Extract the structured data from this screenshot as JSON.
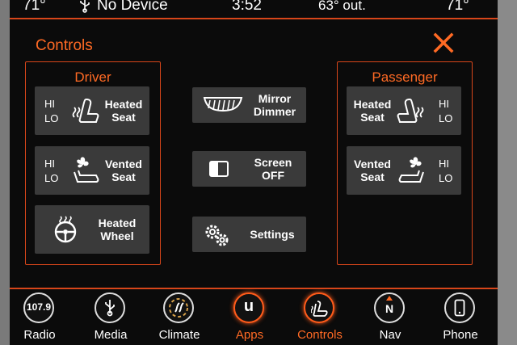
{
  "status": {
    "temp_left": "71°",
    "device": "No Device",
    "time": "3:52",
    "outside": "63° out.",
    "temp_right": "71°"
  },
  "header": {
    "title": "Controls"
  },
  "driver": {
    "title": "Driver",
    "heated_seat": {
      "hi": "HI",
      "lo": "LO",
      "label1": "Heated",
      "label2": "Seat"
    },
    "vented_seat": {
      "hi": "HI",
      "lo": "LO",
      "label1": "Vented",
      "label2": "Seat"
    },
    "heated_wheel": {
      "label1": "Heated",
      "label2": "Wheel"
    }
  },
  "center": {
    "mirror": {
      "label1": "Mirror",
      "label2": "Dimmer"
    },
    "screen": {
      "label1": "Screen",
      "label2": "OFF"
    },
    "settings": {
      "label": "Settings"
    }
  },
  "passenger": {
    "title": "Passenger",
    "heated_seat": {
      "hi": "HI",
      "lo": "LO",
      "label1": "Heated",
      "label2": "Seat"
    },
    "vented_seat": {
      "hi": "HI",
      "lo": "LO",
      "label1": "Vented",
      "label2": "Seat"
    }
  },
  "dock": {
    "items": [
      {
        "label": "Radio",
        "icon_text": "107.9",
        "icon": "radio-icon"
      },
      {
        "label": "Media",
        "icon": "usb-icon"
      },
      {
        "label": "Climate",
        "icon": "climate-icon"
      },
      {
        "label": "Apps",
        "icon_text": "u",
        "icon": "apps-icon"
      },
      {
        "label": "Controls",
        "icon": "controls-icon"
      },
      {
        "label": "Nav",
        "icon_text": "N",
        "icon": "compass-icon"
      },
      {
        "label": "Phone",
        "icon": "phone-icon"
      }
    ],
    "active": [
      "Apps",
      "Controls"
    ]
  },
  "colors": {
    "accent": "#ff6a24",
    "tile": "#3a3a3a",
    "background": "#0b0b0b"
  }
}
